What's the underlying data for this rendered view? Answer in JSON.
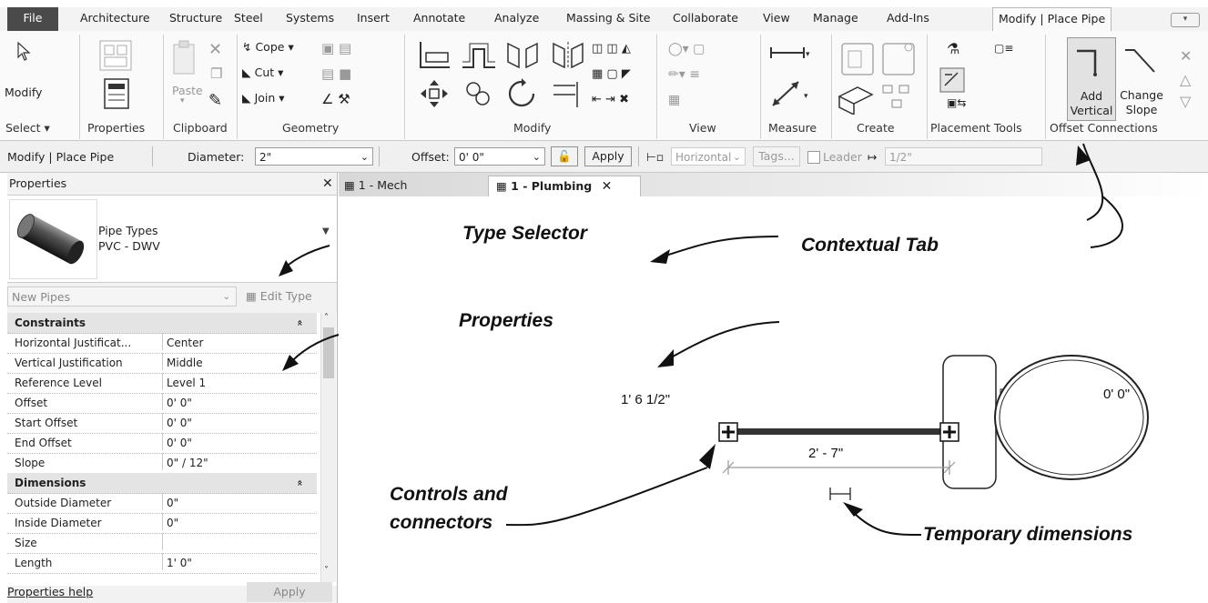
{
  "ribbon_tabs": [
    "File",
    "Architecture",
    "Structure",
    "Steel",
    "Systems",
    "Insert",
    "Annotate",
    "Analyze",
    "Massing & Site",
    "Collaborate",
    "View",
    "Manage",
    "Add-Ins",
    "Modify | Place Pipe"
  ],
  "ribbon": {
    "modify": "Modify",
    "select": "Select",
    "properties": "Properties",
    "paste": "Paste",
    "clipboard": "Clipboard",
    "cope": "Cope",
    "cut": "Cut",
    "join": "Join",
    "geometry": "Geometry",
    "modify_panel": "Modify",
    "view_panel": "View",
    "measure": "Measure",
    "create": "Create",
    "placement_tools": "Placement Tools",
    "add_vertical_1": "Add",
    "add_vertical_2": "Vertical",
    "change_slope_1": "Change",
    "change_slope_2": "Slope",
    "offset_connections": "Offset Connections"
  },
  "options_bar": {
    "context": "Modify | Place Pipe",
    "diameter_label": "Diameter:",
    "diameter_value": "2\"",
    "offset_label": "Offset:",
    "offset_value": "0'  0\"",
    "apply": "Apply",
    "horizontal": "Horizontal",
    "tags": "Tags...",
    "leader": "Leader",
    "leader_length": "1/2\""
  },
  "properties_palette": {
    "title": "Properties",
    "type_family": "Pipe Types",
    "type_name": "PVC - DWV",
    "instance_filter": "New Pipes",
    "edit_type": "Edit Type",
    "rows": [
      {
        "k": "Constraints",
        "v": "",
        "cat": true
      },
      {
        "k": "Horizontal Justificat...",
        "v": "Center"
      },
      {
        "k": "Vertical Justification",
        "v": "Middle"
      },
      {
        "k": "Reference Level",
        "v": "Level 1"
      },
      {
        "k": "Offset",
        "v": "0'  0\""
      },
      {
        "k": "Start Offset",
        "v": "0'  0\""
      },
      {
        "k": "End Offset",
        "v": "0'  0\""
      },
      {
        "k": "Slope",
        "v": "0\" / 12\""
      },
      {
        "k": "Dimensions",
        "v": "",
        "cat": true
      },
      {
        "k": "Outside Diameter",
        "v": "0\""
      },
      {
        "k": "Inside Diameter",
        "v": "0\""
      },
      {
        "k": "Size",
        "v": ""
      },
      {
        "k": "Length",
        "v": "1'  0\""
      }
    ],
    "help_link": "Properties help",
    "apply": "Apply"
  },
  "view_tabs": [
    "1 - Mech",
    "1 - Plumbing"
  ],
  "canvas": {
    "offset_readout": "1'  6 1/2\"",
    "length_dim": "2' - 7\"",
    "fixture_offset": "0'  0\""
  },
  "callouts": {
    "type_selector": "Type Selector",
    "contextual_tab": "Contextual Tab",
    "properties": "Properties",
    "controls_1": "Controls and",
    "controls_2": "connectors",
    "temp_dims": "Temporary dimensions"
  }
}
